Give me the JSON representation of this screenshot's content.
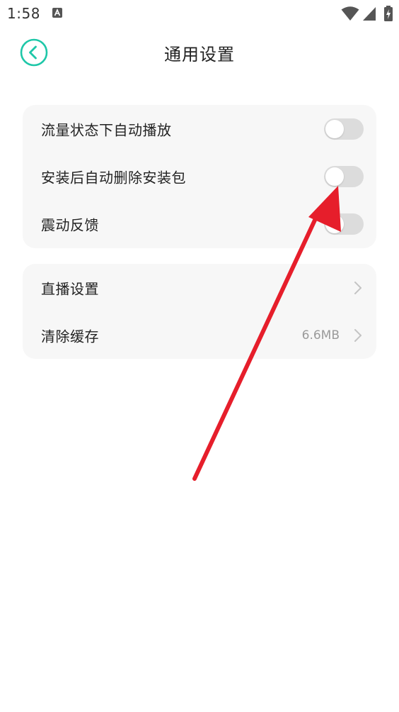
{
  "status_bar": {
    "time": "1:58"
  },
  "header": {
    "title": "通用设置"
  },
  "sections": [
    {
      "items": [
        {
          "label": "流量状态下自动播放",
          "control": "toggle",
          "on": false
        },
        {
          "label": "安装后自动删除安装包",
          "control": "toggle",
          "on": false
        },
        {
          "label": "震动反馈",
          "control": "toggle",
          "on": false
        }
      ]
    },
    {
      "items": [
        {
          "label": "直播设置",
          "control": "chevron",
          "value": ""
        },
        {
          "label": "清除缓存",
          "control": "chevron",
          "value": "6.6MB"
        }
      ]
    }
  ],
  "icons": {
    "back": "chevron-left-circle-icon",
    "chevron": "chevron-right-icon",
    "wifi": "wifi-icon",
    "signal": "cell-signal-icon",
    "battery": "battery-charging-icon"
  },
  "colors": {
    "accent": "#1ec7a8",
    "card_bg": "#f7f7f7",
    "toggle_off": "#dcdcdc",
    "annotation_arrow": "#e61e2b"
  }
}
